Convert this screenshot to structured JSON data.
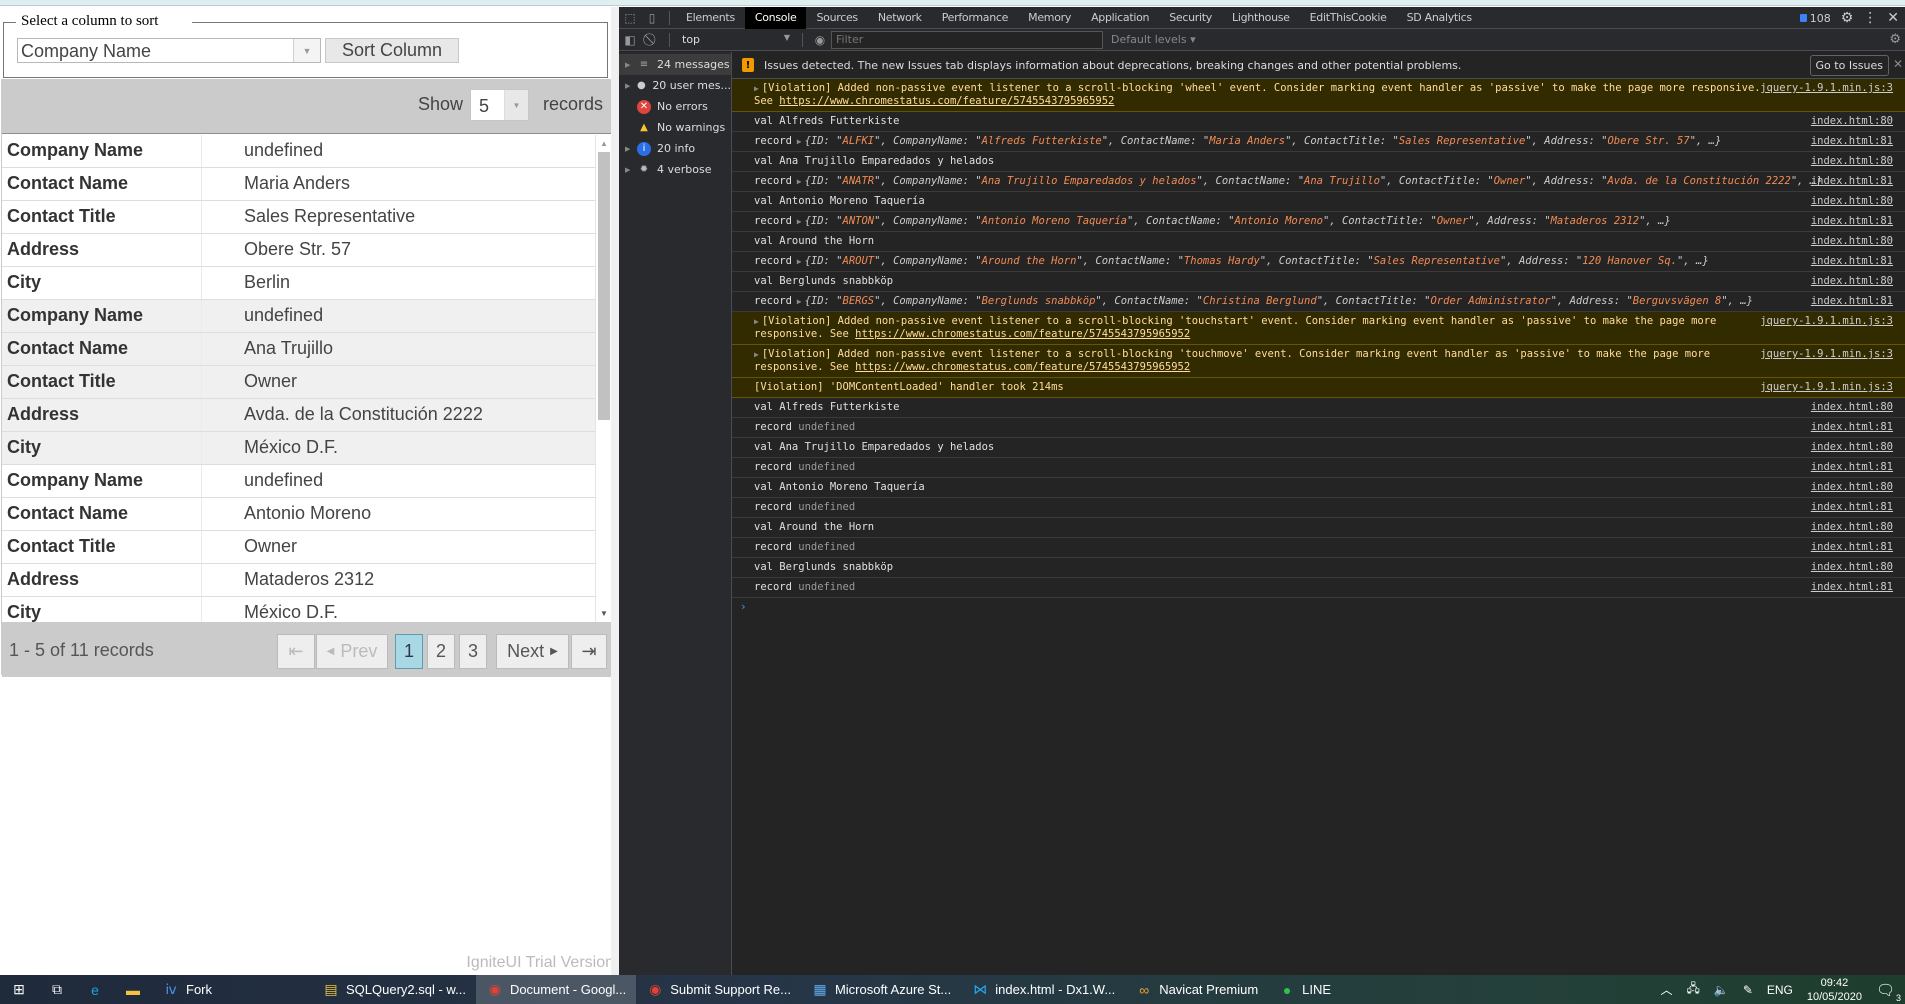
{
  "sort_panel": {
    "legend": "Select a column to sort",
    "column_select_value": "Company Name",
    "sort_button_label": "Sort Column"
  },
  "grid": {
    "show_label": "Show",
    "page_size": "5",
    "records_label": "records",
    "records": [
      {
        "rows": [
          {
            "label": "Company Name",
            "value": "undefined"
          },
          {
            "label": "Contact Name",
            "value": "Maria Anders"
          },
          {
            "label": "Contact Title",
            "value": "Sales Representative"
          },
          {
            "label": "Address",
            "value": "Obere Str. 57"
          },
          {
            "label": "City",
            "value": "Berlin"
          }
        ]
      },
      {
        "rows": [
          {
            "label": "Company Name",
            "value": "undefined"
          },
          {
            "label": "Contact Name",
            "value": "Ana Trujillo"
          },
          {
            "label": "Contact Title",
            "value": "Owner"
          },
          {
            "label": "Address",
            "value": "Avda. de la Constitución 2222"
          },
          {
            "label": "City",
            "value": "México D.F."
          }
        ]
      },
      {
        "rows": [
          {
            "label": "Company Name",
            "value": "undefined"
          },
          {
            "label": "Contact Name",
            "value": "Antonio Moreno"
          },
          {
            "label": "Contact Title",
            "value": "Owner"
          },
          {
            "label": "Address",
            "value": "Mataderos 2312"
          },
          {
            "label": "City",
            "value": "México D.F."
          }
        ]
      }
    ],
    "pager": {
      "summary": "1 - 5 of 11 records",
      "first_icon": "first-page-icon",
      "prev_label": "Prev",
      "pages": [
        "1",
        "2",
        "3"
      ],
      "current_page": "1",
      "next_label": "Next",
      "last_icon": "last-page-icon"
    },
    "trial_notice": "IgniteUI Trial Version"
  },
  "devtools": {
    "tabs": [
      "Elements",
      "Console",
      "Sources",
      "Network",
      "Performance",
      "Memory",
      "Application",
      "Security",
      "Lighthouse",
      "EditThisCookie",
      "SD Analytics"
    ],
    "active_tab": "Console",
    "message_count": "108",
    "context": "top",
    "filter_placeholder": "Filter",
    "levels": "Default levels",
    "sidebar": [
      {
        "label": "24 messages",
        "icon": "list-icon"
      },
      {
        "label": "20 user mes...",
        "icon": "user-icon"
      },
      {
        "label": "No errors",
        "icon": "error-icon"
      },
      {
        "label": "No warnings",
        "icon": "warning-icon"
      },
      {
        "label": "20 info",
        "icon": "info-icon"
      },
      {
        "label": "4 verbose",
        "icon": "bug-icon"
      }
    ],
    "issues_text": "Issues detected. The new Issues tab displays information about deprecations, breaking changes and other potential problems.",
    "go_to_issues": "Go to Issues",
    "messages": [
      {
        "type": "warn",
        "text": "[Violation] Added non-passive event listener to a scroll-blocking 'wheel' event. Consider marking event handler as 'passive' to make the page more responsive. See ",
        "link": "https://www.chromestatus.com/feature/5745543795965952",
        "source": "jquery-1.9.1.min.js:3"
      },
      {
        "type": "log",
        "text": "val Alfreds Futterkiste",
        "source": "index.html:80"
      },
      {
        "type": "obj",
        "prefix": "record",
        "id": "ALFKI",
        "company": "Alfreds Futterkiste",
        "contact": "Maria Anders",
        "title": "Sales Representative",
        "address": "Obere Str. 57",
        "source": "index.html:81"
      },
      {
        "type": "log",
        "text": "val Ana Trujillo Emparedados y helados",
        "source": "index.html:80"
      },
      {
        "type": "obj",
        "prefix": "record",
        "id": "ANATR",
        "company": "Ana Trujillo Emparedados y helados",
        "contact": "Ana Trujillo",
        "title": "Owner",
        "address": "Avda. de la Constitución 2222",
        "source": "index.html:81"
      },
      {
        "type": "log",
        "text": "val Antonio Moreno Taquería",
        "source": "index.html:80"
      },
      {
        "type": "obj",
        "prefix": "record",
        "id": "ANTON",
        "company": "Antonio Moreno Taquería",
        "contact": "Antonio Moreno",
        "title": "Owner",
        "address": "Mataderos  2312",
        "source": "index.html:81"
      },
      {
        "type": "log",
        "text": "val Around the Horn",
        "source": "index.html:80"
      },
      {
        "type": "obj",
        "prefix": "record",
        "id": "AROUT",
        "company": "Around the Horn",
        "contact": "Thomas Hardy",
        "title": "Sales Representative",
        "address": "120 Hanover Sq.",
        "source": "index.html:81"
      },
      {
        "type": "log",
        "text": "val Berglunds snabbköp",
        "source": "index.html:80"
      },
      {
        "type": "obj",
        "prefix": "record",
        "id": "BERGS",
        "company": "Berglunds snabbköp",
        "contact": "Christina Berglund",
        "title": "Order Administrator",
        "address": "Berguvsvägen  8",
        "source": "index.html:81"
      },
      {
        "type": "warn",
        "text": "[Violation] Added non-passive event listener to a scroll-blocking 'touchstart' event. Consider marking event handler as 'passive' to make the page more responsive. See ",
        "link": "https://www.chromestatus.com/feature/5745543795965952",
        "source": "jquery-1.9.1.min.js:3"
      },
      {
        "type": "warn",
        "text": "[Violation] Added non-passive event listener to a scroll-blocking 'touchmove' event. Consider marking event handler as 'passive' to make the page more responsive. See ",
        "link": "https://www.chromestatus.com/feature/5745543795965952",
        "source": "jquery-1.9.1.min.js:3"
      },
      {
        "type": "warn-plain",
        "text": "[Violation] 'DOMContentLoaded' handler took 214ms",
        "source": "jquery-1.9.1.min.js:3"
      },
      {
        "type": "log",
        "text": "val Alfreds Futterkiste",
        "source": "index.html:80"
      },
      {
        "type": "undef",
        "prefix": "record",
        "text": "undefined",
        "source": "index.html:81"
      },
      {
        "type": "log",
        "text": "val Ana Trujillo Emparedados y helados",
        "source": "index.html:80"
      },
      {
        "type": "undef",
        "prefix": "record",
        "text": "undefined",
        "source": "index.html:81"
      },
      {
        "type": "log",
        "text": "val Antonio Moreno Taquería",
        "source": "index.html:80"
      },
      {
        "type": "undef",
        "prefix": "record",
        "text": "undefined",
        "source": "index.html:81"
      },
      {
        "type": "log",
        "text": "val Around the Horn",
        "source": "index.html:80"
      },
      {
        "type": "undef",
        "prefix": "record",
        "text": "undefined",
        "source": "index.html:81"
      },
      {
        "type": "log",
        "text": "val Berglunds snabbköp",
        "source": "index.html:80"
      },
      {
        "type": "undef",
        "prefix": "record",
        "text": "undefined",
        "source": "index.html:81"
      }
    ]
  },
  "taskbar": {
    "items": [
      {
        "label": "",
        "icon": "windows-start-icon",
        "color": "#ffffff"
      },
      {
        "label": "",
        "icon": "task-view-icon",
        "color": "#ffffff"
      },
      {
        "label": "",
        "icon": "edge-icon",
        "color": "#1fa3e0"
      },
      {
        "label": "",
        "icon": "file-explorer-icon",
        "color": "#f5c242"
      },
      {
        "label": "Fork",
        "icon": "fork-icon",
        "color": "#4a90e2"
      },
      {
        "label": "SQLQuery2.sql - w...",
        "icon": "ssms-icon",
        "color": "#e8c23a"
      },
      {
        "label": "Document - Googl...",
        "icon": "chrome-icon",
        "color": "#e34133",
        "active": true
      },
      {
        "label": "Submit Support Re...",
        "icon": "chrome-icon",
        "color": "#e34133"
      },
      {
        "label": "Microsoft Azure St...",
        "icon": "azure-storage-icon",
        "color": "#5fa8e8"
      },
      {
        "label": "index.html - Dx1.W...",
        "icon": "vscode-icon",
        "color": "#23a9f2"
      },
      {
        "label": "Navicat Premium",
        "icon": "navicat-icon",
        "color": "#f0a030"
      },
      {
        "label": "LINE",
        "icon": "line-icon",
        "color": "#2fc14b"
      }
    ],
    "tray": {
      "language": "ENG",
      "time": "09:42",
      "date": "10/05/2020",
      "notification_count": "3"
    }
  }
}
